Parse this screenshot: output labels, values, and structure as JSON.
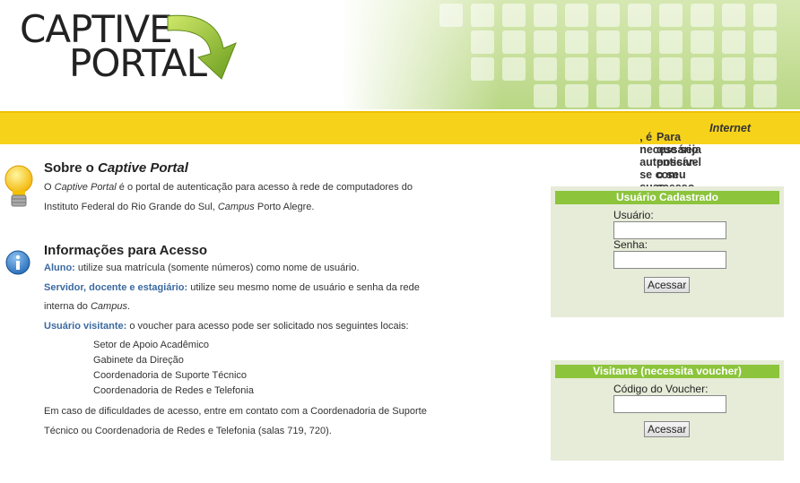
{
  "logo": {
    "line1": "CAPTIVE",
    "line2": "PORTAL"
  },
  "banner": {
    "pre": "Para que seja possível o seu acesso à ",
    "em": "Internet",
    "post": ", é necessário autenticar-se com suas credenciais da rede deste campus."
  },
  "about": {
    "title_pre": "Sobre o ",
    "title_em": "Captive Portal",
    "line1_pre": "O ",
    "line1_em": "Captive Portal",
    "line1_post": " é o portal de autenticação para acesso à rede de computadores do",
    "line2_pre": "Instituto Federal do Rio Grande do Sul, ",
    "line2_em": "Campus",
    "line2_post": " Porto Alegre."
  },
  "info": {
    "title": "Informações para Acesso",
    "aluno_label": "Aluno:",
    "aluno_text": " utilize sua matrícula (somente números) como nome de usuário.",
    "servidor_label": "Servidor, docente e estagiário:",
    "servidor_text": " utilize seu mesmo nome de usuário e senha da rede",
    "servidor_text2_pre": "interna do ",
    "servidor_text2_em": "Campus",
    "servidor_text2_post": ".",
    "visitante_label": "Usuário visitante:",
    "visitante_text": " o voucher para acesso pode ser solicitado nos seguintes locais:",
    "places": [
      "Setor de Apoio Acadêmico",
      "Gabinete da Direção",
      "Coordenadoria de Suporte Técnico",
      "Coordenadoria de Redes e Telefonia"
    ],
    "contact1": "Em caso de dificuldades de acesso, entre em contato com a Coordenadoria de Suporte",
    "contact2": "Técnico ou Coordenadoria de Redes e Telefonia (salas 719, 720)."
  },
  "login_box": {
    "title": "Usuário Cadastrado",
    "user_label": "Usuário:",
    "user_value": "",
    "pass_label": "Senha:",
    "pass_value": "",
    "button": "Acessar"
  },
  "voucher_box": {
    "title": "Visitante (necessita voucher)",
    "code_label": "Código do Voucher:",
    "code_value": "",
    "button": "Acessar"
  },
  "colors": {
    "banner": "#f7d21a",
    "box_title": "#8cc43c",
    "box_bg": "#e6ecd8",
    "link_blue": "#3b6aa0"
  },
  "icons": [
    "lightbulb-icon",
    "info-icon",
    "arrow-logo-icon"
  ]
}
